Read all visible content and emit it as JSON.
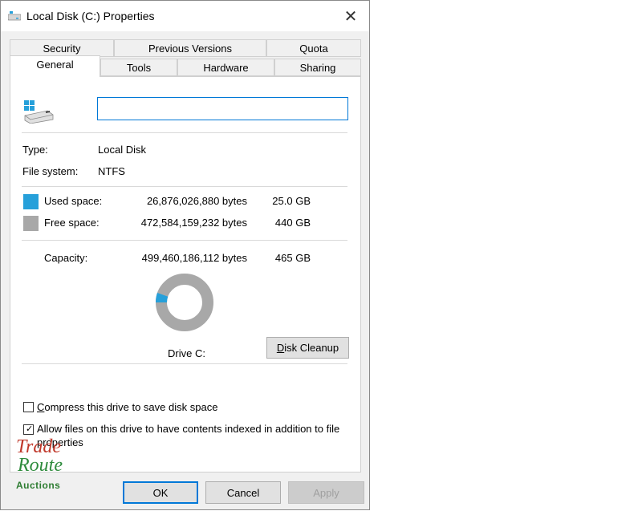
{
  "window": {
    "title": "Local Disk (C:) Properties",
    "close_glyph": "✕"
  },
  "tabs_row1": [
    "Security",
    "Previous Versions",
    "Quota"
  ],
  "tabs_row2": [
    "General",
    "Tools",
    "Hardware",
    "Sharing"
  ],
  "active_tab": "General",
  "general": {
    "drive_name_value": "",
    "type_label": "Type:",
    "type_value": "Local Disk",
    "fs_label": "File system:",
    "fs_value": "NTFS",
    "used_label": "Used space:",
    "used_bytes": "26,876,026,880 bytes",
    "used_gb": "25.0 GB",
    "free_label": "Free space:",
    "free_bytes": "472,584,159,232 bytes",
    "free_gb": "440 GB",
    "capacity_label": "Capacity:",
    "capacity_bytes": "499,460,186,112 bytes",
    "capacity_gb": "465 GB",
    "drive_label": "Drive C:",
    "disk_cleanup_first": "D",
    "disk_cleanup_rest": "isk Cleanup",
    "used_fraction": 0.0538,
    "used_color": "#26a0da",
    "free_color": "#a8a8a8"
  },
  "options": {
    "compress_first": "C",
    "compress_rest": "ompress this drive to save disk space",
    "compress_checked": false,
    "index_line1": "Allow files on this drive to have contents indexed in addition to file",
    "index_line2": "properties",
    "index_checked": true
  },
  "buttons": {
    "ok": "OK",
    "cancel": "Cancel",
    "apply": "Apply"
  },
  "watermark": {
    "line1": "Trade",
    "line2": "Route",
    "line3": "Auctions"
  }
}
